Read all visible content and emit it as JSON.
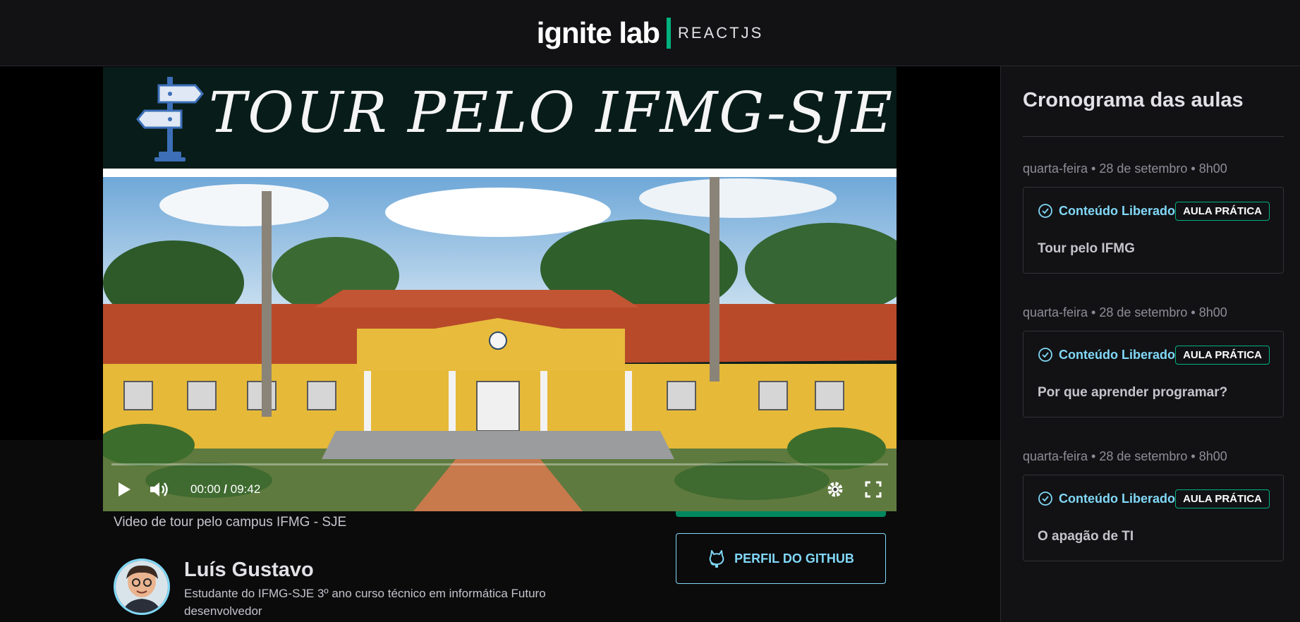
{
  "header": {
    "logo_main": "ignite lab",
    "logo_sub": "REACTJS"
  },
  "video": {
    "banner_title": "TOUR PELO IFMG-SJE",
    "time_current": "00:00",
    "time_separator": "/",
    "time_total": "09:42",
    "progress": 0
  },
  "lesson": {
    "caption": "Video de tour pelo campus IFMG - SJE",
    "author_name": "Luís Gustavo",
    "author_desc": "Estudante do IFMG-SJE 3º ano curso técnico em informática Futuro desenvolvedor",
    "github_label": "PERFIL DO GITHUB"
  },
  "sidebar": {
    "title": "Cronograma das aulas",
    "lessons": [
      {
        "date": "quarta-feira • 28 de setembro • 8h00",
        "status": "Conteúdo Liberado",
        "badge": "AULA PRÁTICA",
        "title": "Tour pelo IFMG"
      },
      {
        "date": "quarta-feira • 28 de setembro • 8h00",
        "status": "Conteúdo Liberado",
        "badge": "AULA PRÁTICA",
        "title": "Por que aprender programar?"
      },
      {
        "date": "quarta-feira • 28 de setembro • 8h00",
        "status": "Conteúdo Liberado",
        "badge": "AULA PRÁTICA",
        "title": "O apagão de TI"
      }
    ]
  },
  "colors": {
    "accent_green": "#00b37e",
    "accent_blue": "#81d8f7",
    "background": "#0b0b0c",
    "panel": "#121214"
  },
  "icons": [
    "signpost-icon",
    "play-icon",
    "volume-icon",
    "settings-icon",
    "fullscreen-icon",
    "github-icon",
    "check-circle-icon"
  ]
}
